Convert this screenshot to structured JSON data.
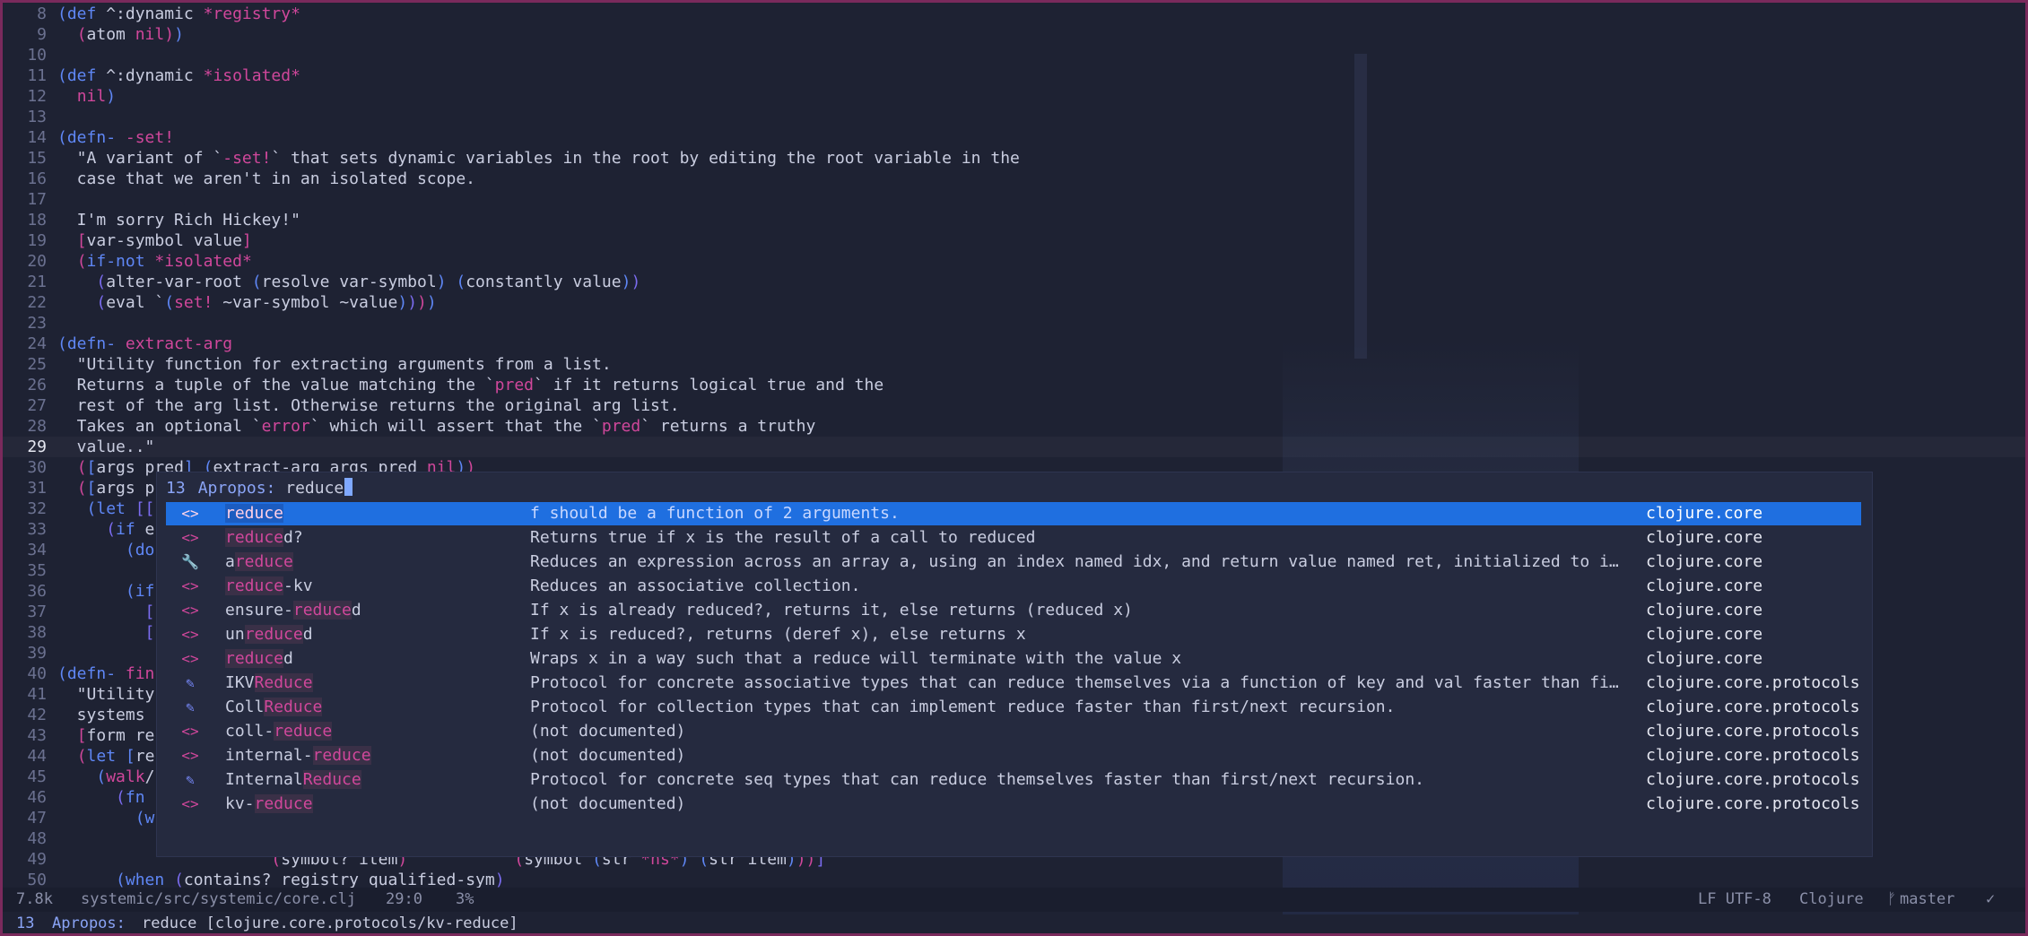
{
  "lines": [
    {
      "n": "8",
      "html": "<span class=\"p1\">(</span><span class=\"k\">def</span> ^:dynamic <span class=\"m\">*registry*</span>"
    },
    {
      "n": "9",
      "html": "  <span class=\"p2\">(</span>atom <span class=\"n\">nil</span><span class=\"p2\">)</span><span class=\"p1\">)</span>"
    },
    {
      "n": "10",
      "html": ""
    },
    {
      "n": "11",
      "html": "<span class=\"p1\">(</span><span class=\"k\">def</span> ^:dynamic <span class=\"m\">*isolated*</span>"
    },
    {
      "n": "12",
      "html": "  <span class=\"n\">nil</span><span class=\"p1\">)</span>"
    },
    {
      "n": "13",
      "html": ""
    },
    {
      "n": "14",
      "html": "<span class=\"p1\">(</span><span class=\"k\">defn-</span> <span class=\"m\">-set!</span>"
    },
    {
      "n": "15",
      "html": "  \"A variant of `<span class=\"m\">-set!</span>` that sets dynamic variables in the root by editing the root variable in the"
    },
    {
      "n": "16",
      "html": "  case that we aren't in an isolated scope."
    },
    {
      "n": "17",
      "html": ""
    },
    {
      "n": "18",
      "html": "  I'm sorry Rich Hickey!\""
    },
    {
      "n": "19",
      "html": "  <span class=\"p2\">[</span>var-symbol value<span class=\"p2\">]</span>"
    },
    {
      "n": "20",
      "html": "  <span class=\"p2\">(</span><span class=\"k\">if-not</span> <span class=\"m\">*isolated*</span>"
    },
    {
      "n": "21",
      "html": "    <span class=\"p3\">(</span>alter-var-root <span class=\"p1\">(</span>resolve var-symbol<span class=\"p1\">)</span> <span class=\"p1\">(</span>constantly value<span class=\"p1\">)</span><span class=\"p3\">)</span>"
    },
    {
      "n": "22",
      "html": "    <span class=\"p3\">(</span>eval `<span class=\"p1\">(</span><span class=\"m\">set!</span> ~var-symbol ~value<span class=\"p1\">)</span><span class=\"p3\">)</span><span class=\"p2\">)</span><span class=\"p1\">)</span>"
    },
    {
      "n": "23",
      "html": ""
    },
    {
      "n": "24",
      "html": "<span class=\"p1\">(</span><span class=\"k\">defn-</span> <span class=\"m\">extract-arg</span>"
    },
    {
      "n": "25",
      "html": "  \"Utility function for extracting arguments from a list."
    },
    {
      "n": "26",
      "html": "  Returns a tuple of the value matching the `<span class=\"m\">pred</span>` if it returns logical true and the"
    },
    {
      "n": "27",
      "html": "  rest of the arg list. Otherwise returns the original arg list."
    },
    {
      "n": "28",
      "html": "  Takes an optional `<span class=\"m\">error</span>` which will assert that the `<span class=\"m\">pred</span>` returns a truthy"
    },
    {
      "n": "29",
      "html": "  value..\"",
      "current": true
    },
    {
      "n": "30",
      "html": "  <span class=\"p2\">(</span><span class=\"p1\">[</span>args pred<span class=\"p1\">]</span> <span class=\"p1\">(</span>extract-arg args pred <span class=\"n\">nil</span><span class=\"p1\">)</span><span class=\"p2\">)</span>"
    },
    {
      "n": "31",
      "html": "  <span class=\"p2\">(</span><span class=\"p1\">[</span>args p"
    },
    {
      "n": "32",
      "html": "   <span class=\"p1\">(</span><span class=\"k\">let</span> <span class=\"p3\">[[</span>"
    },
    {
      "n": "33",
      "html": "     <span class=\"p3\">(</span><span class=\"k\">if</span> e"
    },
    {
      "n": "34",
      "html": "       <span class=\"p1\">(</span><span class=\"k\">do</span>"
    },
    {
      "n": "35",
      "html": ""
    },
    {
      "n": "36",
      "html": "       <span class=\"p1\">(</span><span class=\"k\">if</span>"
    },
    {
      "n": "37",
      "html": "         <span class=\"p3\">[</span>"
    },
    {
      "n": "38",
      "html": "         <span class=\"p3\">[</span>"
    },
    {
      "n": "39",
      "html": ""
    },
    {
      "n": "40",
      "html": "<span class=\"p1\">(</span><span class=\"k\">defn-</span> <span class=\"m\">fin</span>"
    },
    {
      "n": "41",
      "html": "  \"Utility"
    },
    {
      "n": "42",
      "html": "  systems"
    },
    {
      "n": "43",
      "html": "  <span class=\"p2\">[</span>form re"
    },
    {
      "n": "44",
      "html": "  <span class=\"p2\">(</span><span class=\"k\">let</span> <span class=\"p1\">[</span>re"
    },
    {
      "n": "45",
      "html": "    <span class=\"p1\">(</span><span class=\"m\">walk</span>/"
    },
    {
      "n": "46",
      "html": "      <span class=\"p3\">(</span><span class=\"k\">fn</span>"
    },
    {
      "n": "47",
      "html": "        <span class=\"p1\">(</span><span class=\"k\">w</span>"
    },
    {
      "n": "48",
      "html": ""
    },
    {
      "n": "49",
      "html": "                      <span class=\"p2\">(</span>symbol? item<span class=\"p2\">)</span>           <span class=\"p2\">(</span>symbol <span class=\"p1\">(</span>str <span class=\"m\">*ns*</span><span class=\"p1\">)</span> <span class=\"p1\">(</span>str item<span class=\"p1\">)</span><span class=\"p2\">))</span><span class=\"p3\">]</span>"
    },
    {
      "n": "50",
      "html": "      <span class=\"p1\">(</span><span class=\"k\">when</span> <span class=\"p3\">(</span>contains? registry qualified-sym<span class=\"p3\">)</span>"
    }
  ],
  "apropos": {
    "count": "13",
    "label": "Apropos:",
    "query": "reduce",
    "results": [
      {
        "icon": "function-icon",
        "glyph": "<>",
        "pre": "",
        "hl": "reduce",
        "post": "",
        "doc": "f should be a function of 2 arguments.",
        "ns": "clojure.core",
        "selected": true
      },
      {
        "icon": "function-icon",
        "glyph": "<>",
        "pre": "",
        "hl": "reduce",
        "post": "d?",
        "doc": "Returns true if x is the result of a call to reduced",
        "ns": "clojure.core"
      },
      {
        "icon": "macro-wrench-icon",
        "glyph": "🔧",
        "pre": "a",
        "hl": "reduce",
        "post": "",
        "doc": "Reduces an expression across an array a, using an index named idx, and return value named ret, initialized to i…",
        "ns": "clojure.core"
      },
      {
        "icon": "function-icon",
        "glyph": "<>",
        "pre": "",
        "hl": "reduce",
        "post": "-kv",
        "doc": "Reduces an associative collection.",
        "ns": "clojure.core"
      },
      {
        "icon": "function-icon",
        "glyph": "<>",
        "pre": "ensure-",
        "hl": "reduce",
        "post": "d",
        "doc": "If x is already reduced?, returns it, else returns (reduced x)",
        "ns": "clojure.core"
      },
      {
        "icon": "function-icon",
        "glyph": "<>",
        "pre": "un",
        "hl": "reduce",
        "post": "d",
        "doc": "If x is reduced?, returns (deref x), else returns x",
        "ns": "clojure.core"
      },
      {
        "icon": "function-icon",
        "glyph": "<>",
        "pre": "",
        "hl": "reduce",
        "post": "d",
        "doc": "Wraps x in a way such that a reduce will terminate with the value x",
        "ns": "clojure.core"
      },
      {
        "icon": "protocol-pen-icon",
        "glyph": "✎",
        "pre": "IKV",
        "hl": "Reduce",
        "post": "",
        "doc": "Protocol for concrete associative types that can reduce themselves via a function of key and val faster than fi…",
        "ns": "clojure.core.protocols"
      },
      {
        "icon": "protocol-pen-icon",
        "glyph": "✎",
        "pre": "Coll",
        "hl": "Reduce",
        "post": "",
        "doc": "Protocol for collection types that can implement reduce faster than first/next recursion.",
        "ns": "clojure.core.protocols"
      },
      {
        "icon": "function-icon",
        "glyph": "<>",
        "pre": "coll-",
        "hl": "reduce",
        "post": "",
        "doc": "(not documented)",
        "ns": "clojure.core.protocols"
      },
      {
        "icon": "function-icon",
        "glyph": "<>",
        "pre": "internal-",
        "hl": "reduce",
        "post": "",
        "doc": "(not documented)",
        "ns": "clojure.core.protocols"
      },
      {
        "icon": "protocol-pen-icon",
        "glyph": "✎",
        "pre": "Internal",
        "hl": "Reduce",
        "post": "",
        "doc": "Protocol for concrete seq types that can reduce themselves faster than first/next recursion.",
        "ns": "clojure.core.protocols"
      },
      {
        "icon": "function-icon",
        "glyph": "<>",
        "pre": "kv-",
        "hl": "reduce",
        "post": "",
        "doc": "(not documented)",
        "ns": "clojure.core.protocols"
      }
    ]
  },
  "modeline": {
    "size": "7.8k",
    "path": "systemic/src/systemic/core.clj",
    "position": "29:0",
    "percent": "3%",
    "encoding": "LF UTF-8",
    "mode": "Clojure",
    "branch_glyph": "ᚠ",
    "branch": "master",
    "check_glyph": "✓"
  },
  "minibuffer": {
    "count": "13",
    "label": "Apropos:",
    "value": "reduce [clojure.core.protocols/kv-reduce]"
  }
}
